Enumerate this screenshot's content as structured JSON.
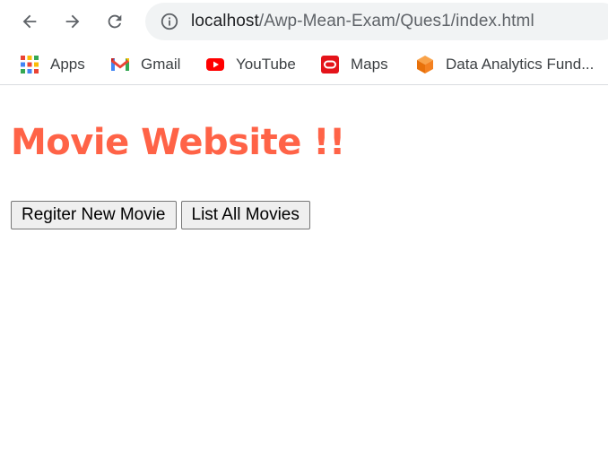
{
  "browser": {
    "back_icon": "arrow-left-icon",
    "forward_icon": "arrow-right-icon",
    "reload_icon": "reload-icon",
    "address": {
      "info_icon": "info-icon",
      "host": "localhost",
      "path": "/Awp-Mean-Exam/Ques1/index.html"
    },
    "bookmarks": [
      {
        "label": "Apps",
        "icon": "apps-grid-icon"
      },
      {
        "label": "Gmail",
        "icon": "gmail-icon"
      },
      {
        "label": "YouTube",
        "icon": "youtube-icon"
      },
      {
        "label": "Maps",
        "icon": "maps-icon"
      },
      {
        "label": "Data Analytics Fund...",
        "icon": "cube-icon"
      }
    ]
  },
  "page": {
    "title": "Movie Website !!",
    "buttons": {
      "register": "Regiter New Movie",
      "list": "List All Movies"
    }
  },
  "colors": {
    "title": "#ff6347",
    "omnibox_bg": "#f1f3f4",
    "youtube": "#ff0000",
    "maps": "#e4141a",
    "cube": "#f48120"
  }
}
